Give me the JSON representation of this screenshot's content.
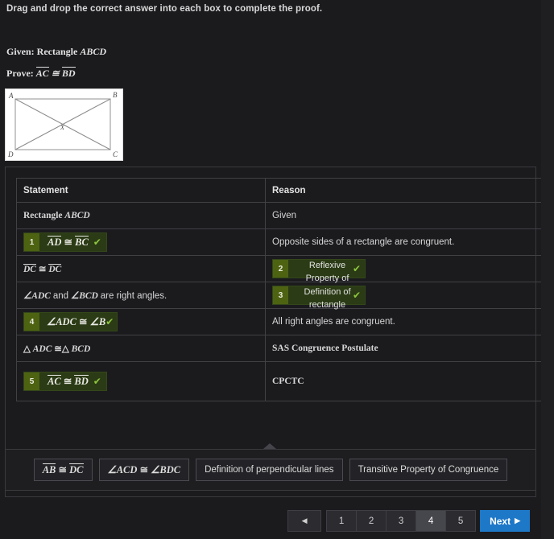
{
  "instruction": "Drag and drop the correct answer into each box to complete the proof.",
  "problem": {
    "given_label": "Given:",
    "given_text": "Rectangle",
    "given_math": "ABCD",
    "prove_label": "Prove:",
    "prove_seg1": "AC",
    "prove_rel": "≅",
    "prove_seg2": "BD"
  },
  "figure": {
    "vertex_a": "A",
    "vertex_b": "B",
    "vertex_c": "C",
    "vertex_d": "D",
    "center": "X"
  },
  "table": {
    "headers": {
      "statement": "Statement",
      "reason": "Reason"
    },
    "rows": [
      {
        "statement_type": "text",
        "statement": "Rectangle ABCD",
        "reason_type": "text",
        "reason": "Given"
      },
      {
        "statement_type": "chip",
        "chip_number": "1",
        "statement": "AD ≅ BC",
        "reason_type": "text",
        "reason": "Opposite sides of a rectangle are congruent."
      },
      {
        "statement_type": "text",
        "statement": "DC ≅ DC",
        "reason_type": "chip",
        "chip_number": "2",
        "reason": "Reflexive Property of Congruence"
      },
      {
        "statement_type": "text",
        "statement": "∠ADC and ∠BCD are right angles.",
        "reason_type": "chip",
        "chip_number": "3",
        "reason": "Definition of rectangle"
      },
      {
        "statement_type": "chip",
        "chip_number": "4",
        "statement": "∠ADC ≅ ∠B",
        "reason_type": "text",
        "reason": "All right angles are congruent."
      },
      {
        "statement_type": "text",
        "statement": "△ ADC ≅△ BCD",
        "reason_type": "text",
        "reason": "SAS Congruence Postulate"
      },
      {
        "statement_type": "chip",
        "chip_number": "5",
        "statement": "AC ≅ BD",
        "reason_type": "text",
        "reason": "CPCTC"
      }
    ],
    "checkmark": "✔"
  },
  "answer_bank": {
    "tiles": [
      {
        "label": "AB ≅ DC",
        "math": true
      },
      {
        "label": "∠ACD ≅ ∠BDC",
        "math": true
      },
      {
        "label": "Definition of perpendicular lines",
        "math": false
      },
      {
        "label": "Transitive Property of Congruence",
        "math": false
      }
    ]
  },
  "pagination": {
    "prev_glyph": "◀",
    "pages": [
      "1",
      "2",
      "3",
      "4",
      "5"
    ],
    "active_page": "4",
    "next_label": "Next",
    "next_glyph": "▶"
  },
  "colors": {
    "page_background": "#1b1b1e",
    "chip_body": "#2b3b15",
    "chip_badge": "#4e6312",
    "check_green": "#8ec63f",
    "next_blue": "#1e78c8",
    "active_page": "#46464d"
  }
}
